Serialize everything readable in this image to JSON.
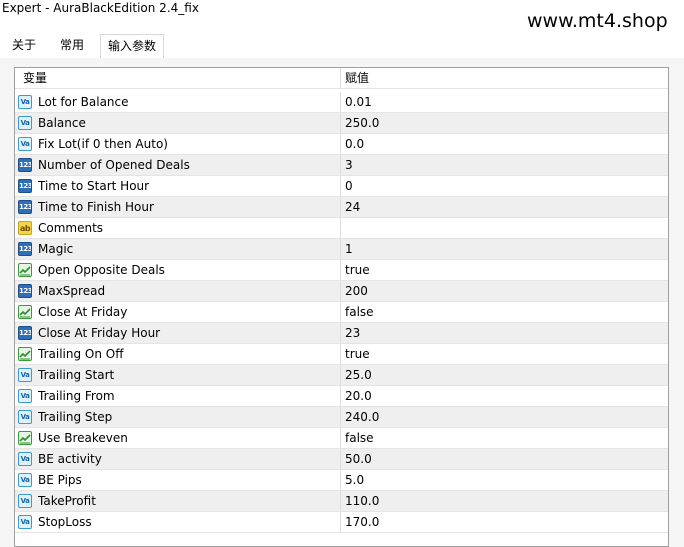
{
  "window": {
    "title": "Expert - AuraBlackEdition 2.4_fix"
  },
  "watermark": "www.mt4.shop",
  "tabs": [
    {
      "label": "关于"
    },
    {
      "label": "常用"
    },
    {
      "label": "输入参数",
      "active": true
    }
  ],
  "grid": {
    "columns": {
      "name": "变量",
      "value": "赋值"
    },
    "rows": [
      {
        "icon": "va",
        "name": "Lot for Balance",
        "value": "0.01"
      },
      {
        "icon": "va",
        "name": "Balance",
        "value": "250.0"
      },
      {
        "icon": "va",
        "name": "Fix Lot(if 0 then Auto)",
        "value": "0.0"
      },
      {
        "icon": "123",
        "name": "Number of Opened Deals",
        "value": "3"
      },
      {
        "icon": "123",
        "name": "Time to Start Hour",
        "value": "0"
      },
      {
        "icon": "123",
        "name": "Time to Finish Hour",
        "value": "24"
      },
      {
        "icon": "ab",
        "name": "Comments",
        "value": ""
      },
      {
        "icon": "123",
        "name": "Magic",
        "value": "1"
      },
      {
        "icon": "bool",
        "name": "Open Opposite Deals",
        "value": "true"
      },
      {
        "icon": "123",
        "name": "MaxSpread",
        "value": "200"
      },
      {
        "icon": "bool",
        "name": "Close At Friday",
        "value": "false"
      },
      {
        "icon": "123",
        "name": "Close At Friday Hour",
        "value": "23"
      },
      {
        "icon": "bool",
        "name": "Trailing On Off",
        "value": "true"
      },
      {
        "icon": "va",
        "name": "Trailing Start",
        "value": "25.0"
      },
      {
        "icon": "va",
        "name": "Trailing From",
        "value": "20.0"
      },
      {
        "icon": "va",
        "name": "Trailing Step",
        "value": "240.0"
      },
      {
        "icon": "bool",
        "name": "Use Breakeven",
        "value": "false"
      },
      {
        "icon": "va",
        "name": "BE activity",
        "value": "50.0"
      },
      {
        "icon": "va",
        "name": "BE Pips",
        "value": "5.0"
      },
      {
        "icon": "va",
        "name": "TakeProfit",
        "value": "110.0"
      },
      {
        "icon": "va",
        "name": "StopLoss",
        "value": "170.0"
      }
    ]
  },
  "icon_labels": {
    "va": "Va",
    "123": "123",
    "ab": "ab"
  }
}
